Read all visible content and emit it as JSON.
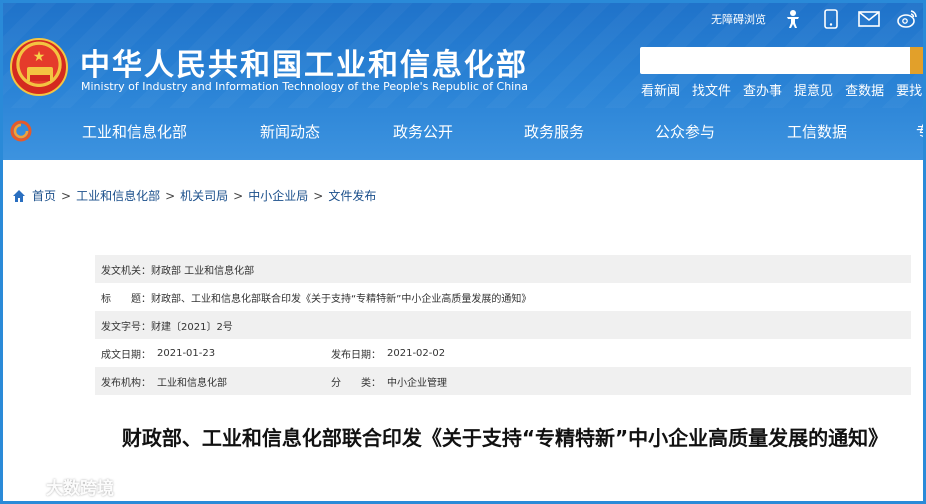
{
  "header": {
    "title": "中华人民共和国工业和信息化部",
    "subtitle": "Ministry of Industry and Information Technology of the People's Republic of China",
    "accessibility_link": "无障碍浏览",
    "top_icons": [
      "accessibility-person-icon",
      "mobile-phone-icon",
      "mail-icon",
      "weibo-icon"
    ],
    "search": {
      "value": "",
      "placeholder": ""
    },
    "quick_links": [
      "看新闻",
      "找文件",
      "查办事",
      "提意见",
      "查数据",
      "要找"
    ]
  },
  "nav": {
    "items": [
      "工业和信息化部",
      "新闻动态",
      "政务公开",
      "政务服务",
      "公众参与",
      "工信数据",
      "专"
    ]
  },
  "breadcrumb": [
    "首页",
    "工业和信息化部",
    "机关司局",
    "中小企业局",
    "文件发布"
  ],
  "meta": {
    "issuer_label": "发文机关：",
    "issuer_value": "财政部 工业和信息化部",
    "title_label": "标　　题：",
    "title_value": "财政部、工业和信息化部联合印发《关于支持“专精特新”中小企业高质量发展的通知》",
    "doc_no_label": "发文字号：",
    "doc_no_value": "财建〔2021〕2号",
    "written_date_label": "成文日期：",
    "written_date_value": "2021-01-23",
    "publish_date_label": "发布日期：",
    "publish_date_value": "2021-02-02",
    "publisher_label": "发布机构：",
    "publisher_value": "工业和信息化部",
    "category_label": "分　　类：",
    "category_value": "中小企业管理"
  },
  "document": {
    "title": "财政部、工业和信息化部联合印发《关于支持“专精特新”中小企业高质量发展的通知》"
  },
  "watermark": {
    "text": "大数跨境"
  },
  "colors": {
    "header_blue": "#2a83d6",
    "nav_text": "#ffffff",
    "search_button": "#e2a02a",
    "breadcrumb_link": "#1a4f8b"
  }
}
